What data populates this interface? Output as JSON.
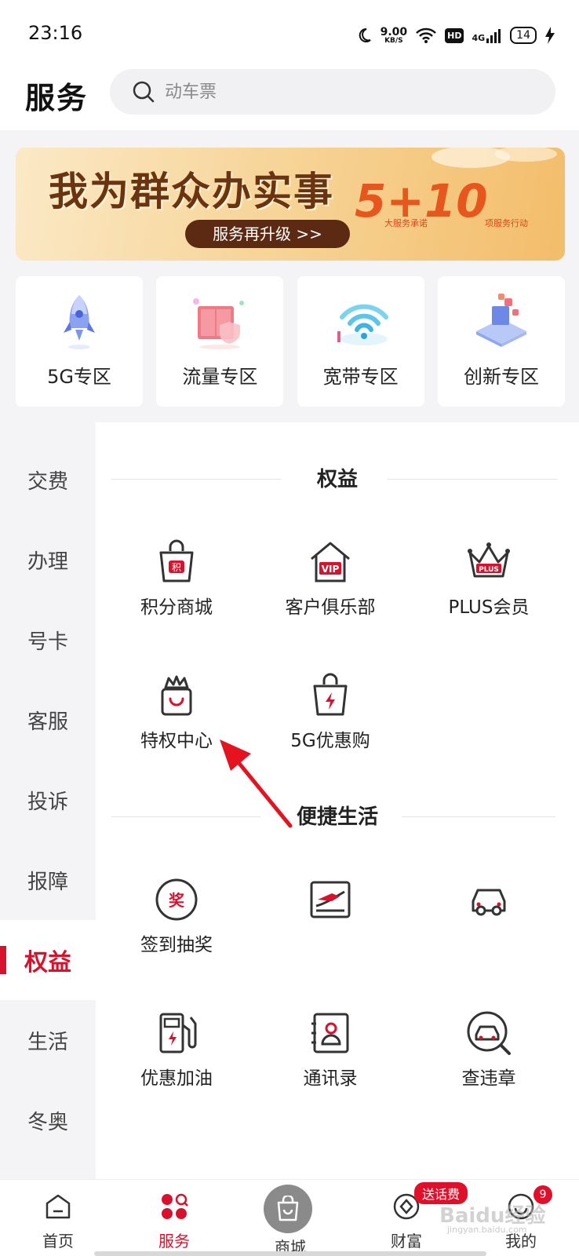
{
  "status_bar": {
    "time": "23:16",
    "net_speed_value": "9.00",
    "net_speed_unit": "KB/S",
    "hd": "HD",
    "network": "4G",
    "battery": "14"
  },
  "header": {
    "title": "服务",
    "search_placeholder": "动车票"
  },
  "banner": {
    "title": "我为群众办实事",
    "button": "服务再升级 >>",
    "highlight": "5+10",
    "sub_left": "大服务承诺",
    "sub_right": "项服务行动"
  },
  "zones": [
    {
      "label": "5G专区",
      "icon": "rocket-icon"
    },
    {
      "label": "流量专区",
      "icon": "data-box-icon"
    },
    {
      "label": "宽带专区",
      "icon": "wifi-icon"
    },
    {
      "label": "创新专区",
      "icon": "innovation-icon"
    }
  ],
  "sidebar": {
    "items": [
      {
        "label": "交费"
      },
      {
        "label": "办理"
      },
      {
        "label": "号卡"
      },
      {
        "label": "客服"
      },
      {
        "label": "投诉"
      },
      {
        "label": "报障"
      },
      {
        "label": "权益"
      },
      {
        "label": "生活"
      },
      {
        "label": "冬奥"
      }
    ],
    "active": "权益"
  },
  "sections": {
    "benefits": {
      "title": "权益",
      "items": [
        {
          "label": "积分商城",
          "icon": "points-bag-icon",
          "icon_text": "积"
        },
        {
          "label": "客户俱乐部",
          "icon": "vip-house-icon",
          "icon_text": "VIP"
        },
        {
          "label": "PLUS会员",
          "icon": "plus-crown-icon",
          "icon_text": "PLUS"
        },
        {
          "label": "特权中心",
          "icon": "crown-bag-icon"
        },
        {
          "label": "5G优惠购",
          "icon": "bolt-bag-icon"
        }
      ]
    },
    "life": {
      "title": "便捷生活",
      "items": [
        {
          "label": "签到抽奖",
          "icon": "lottery-icon",
          "icon_text": "奖"
        },
        {
          "label": "",
          "icon": "train-ticket-icon"
        },
        {
          "label": "",
          "icon": "car-icon"
        },
        {
          "label": "优惠加油",
          "icon": "fuel-pump-icon"
        },
        {
          "label": "通讯录",
          "icon": "contacts-icon"
        },
        {
          "label": "查违章",
          "icon": "car-search-icon"
        }
      ]
    }
  },
  "bottom_nav": {
    "items": [
      {
        "label": "首页",
        "icon": "home-icon"
      },
      {
        "label": "服务",
        "icon": "services-icon"
      },
      {
        "label": "商城",
        "icon": "shopping-bag-icon"
      },
      {
        "label": "财富",
        "icon": "wealth-icon"
      },
      {
        "label": "我的",
        "icon": "profile-icon"
      }
    ],
    "active": "服务",
    "wealth_badge": "送话费",
    "profile_badge": "9"
  },
  "watermark": {
    "text": "Baidu经验",
    "sub": "jingyan.baidu.com"
  },
  "colors": {
    "accent": "#d8112d",
    "icon_stroke": "#333333",
    "banner_text": "#6b3410"
  }
}
